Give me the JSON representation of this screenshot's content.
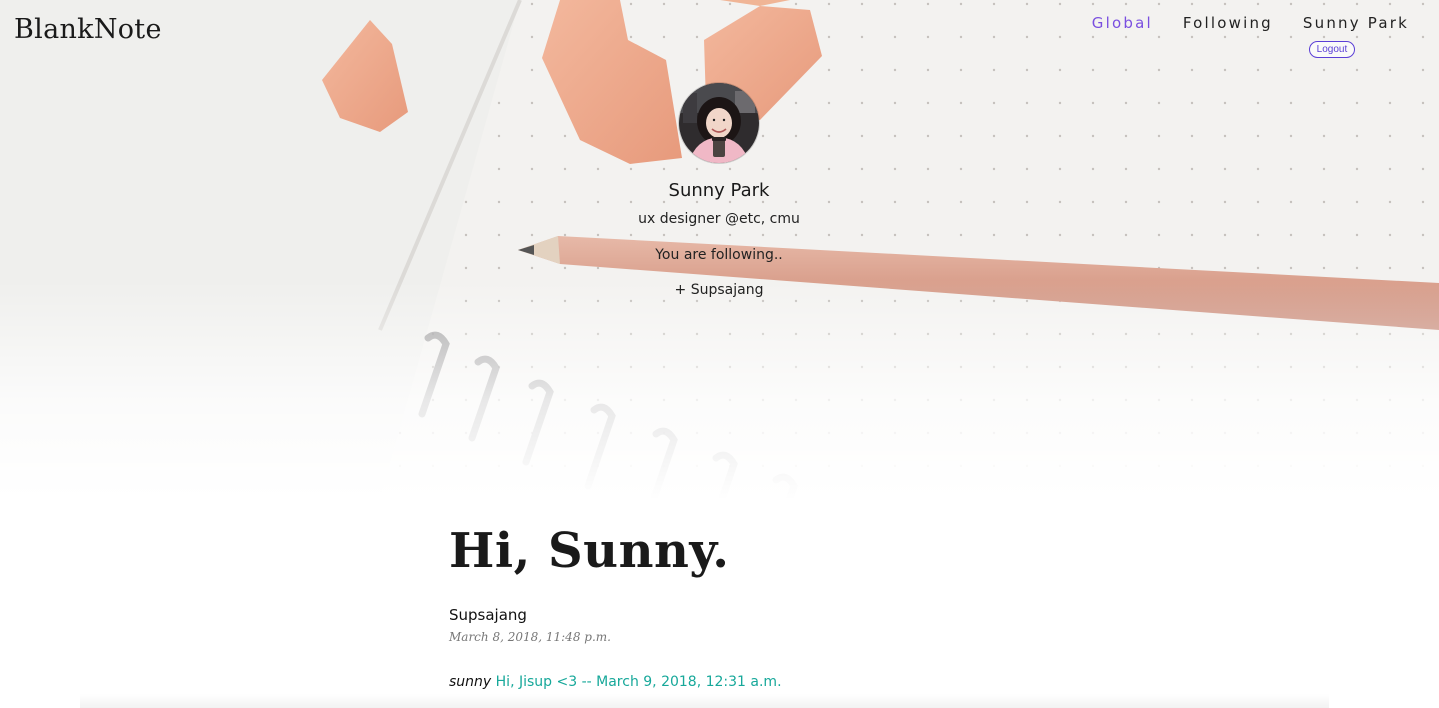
{
  "header": {
    "brand": "BlankNote",
    "nav": {
      "global_label": "Global",
      "following_label": "Following",
      "user_label": "Sunny Park",
      "logout_label": "Logout"
    }
  },
  "profile": {
    "name": "Sunny Park",
    "bio": "ux designer @etc, cmu",
    "following_label": "You are following..",
    "following": [
      "+ Supsajang"
    ]
  },
  "main": {
    "greeting": "Hi, Sunny.",
    "posts": [
      {
        "author": "Supsajang",
        "date": "March 8, 2018, 11:48 p.m.",
        "comments": [
          {
            "author": "sunny",
            "text": "Hi, Jisup <3 -- March 9, 2018, 12:31 a.m."
          }
        ]
      }
    ]
  },
  "colors": {
    "accent": "#7a4fe0",
    "logout": "#5b3fd6",
    "comment": "#17a89a",
    "date": "#777777"
  }
}
